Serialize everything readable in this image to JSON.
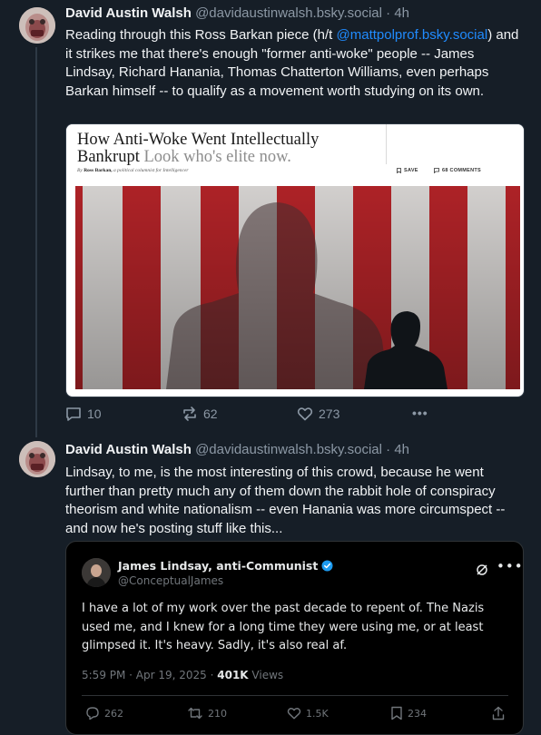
{
  "posts": [
    {
      "author": "David Austin Walsh",
      "handle": "@davidaustinwalsh.bsky.social",
      "dot": "·",
      "time": "4h",
      "text_before": "Reading through this Ross Barkan piece (h/t ",
      "mention": "@mattpolprof.bsky.social",
      "text_after": ") and it strikes me that there's enough \"former anti-woke\" people -- James Lindsay, Richard Hanania, Thomas Chatterton Williams, even perhaps Barkan himself -- to qualify as a movement worth studying on its own.",
      "card": {
        "title": "How Anti-Woke Went Intellectually Bankrupt",
        "subtitle": "Look who's elite now.",
        "byline_prefix": "By",
        "byline_author": "Ross Barkan,",
        "byline_role": "a political columnist for Intelligencer",
        "save_label": "SAVE",
        "comments_label": "68 COMMENTS"
      },
      "actions": {
        "replies": "10",
        "reposts": "62",
        "likes": "273",
        "more": "•••"
      }
    },
    {
      "author": "David Austin Walsh",
      "handle": "@davidaustinwalsh.bsky.social",
      "dot": "·",
      "time": "4h",
      "text": "Lindsay, to me, is the most interesting of this crowd, because he went further than pretty much any of them down the rabbit hole of conspiracy theorism and white nationalism -- even Hanania was more circumspect -- and now he's posting stuff like this...",
      "embed": {
        "name": "James Lindsay, anti-Communist",
        "handle": "@ConceptualJames",
        "more": "•••",
        "text": "I have a lot of my work over the past decade to repent of. The Nazis used me, and I knew for a long time they were using me, or at least glimpsed it. It's heavy. Sadly, it's also real af.",
        "timestamp": "5:59 PM · Apr 19, 2025 · ",
        "views_count": "401K",
        "views_label": " Views",
        "replies": "262",
        "reposts": "210",
        "likes": "1.5K",
        "bookmarks": "234"
      }
    }
  ],
  "colors": {
    "background": "#161e27",
    "text": "#f1f3f5",
    "muted": "#8c98a5",
    "link": "#208bfe",
    "verified": "#1d9bf0"
  }
}
